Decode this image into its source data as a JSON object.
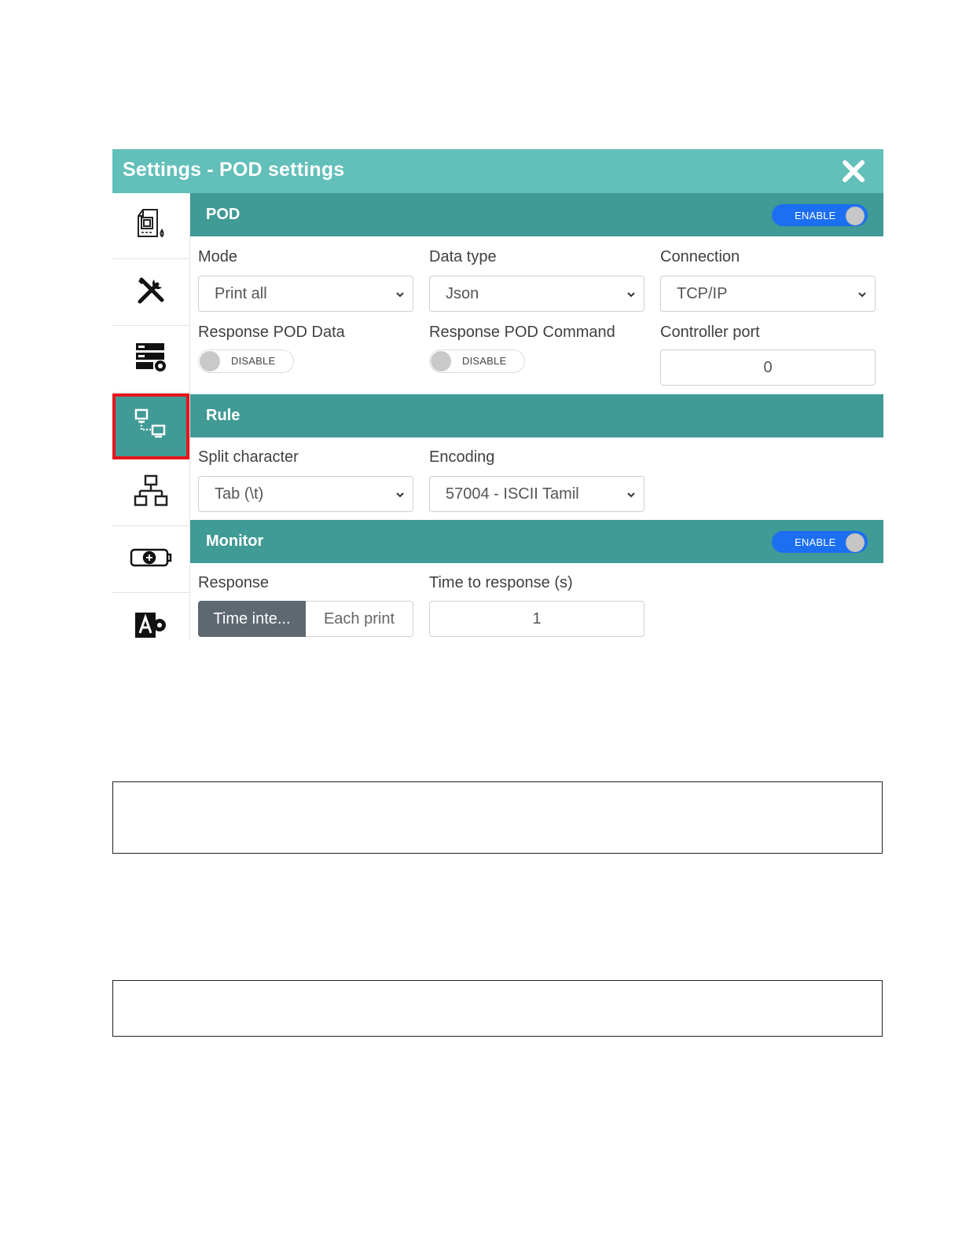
{
  "dialog": {
    "title": "Settings - POD settings",
    "close_icon": "close-icon"
  },
  "sidebar": {
    "items": [
      {
        "icon": "printer-ink-icon",
        "active": false
      },
      {
        "icon": "tools-icon",
        "active": false
      },
      {
        "icon": "server-settings-icon",
        "active": false
      },
      {
        "icon": "network-computers-icon",
        "active": true
      },
      {
        "icon": "hierarchy-icon",
        "active": false
      },
      {
        "icon": "battery-add-icon",
        "active": false
      },
      {
        "icon": "translate-settings-icon",
        "active": false
      }
    ]
  },
  "pod": {
    "title": "POD",
    "toggle": "ENABLE",
    "mode_label": "Mode",
    "mode_value": "Print all",
    "data_type_label": "Data type",
    "data_type_value": "Json",
    "connection_label": "Connection",
    "connection_value": "TCP/IP",
    "response_data_label": "Response POD Data",
    "response_data_toggle": "DISABLE",
    "response_command_label": "Response POD Command",
    "response_command_toggle": "DISABLE",
    "controller_port_label": "Controller port",
    "controller_port_value": "0"
  },
  "rule": {
    "title": "Rule",
    "split_label": "Split character",
    "split_value": "Tab (\\t)",
    "encoding_label": "Encoding",
    "encoding_value": "57004 - ISCII Tamil"
  },
  "monitor": {
    "title": "Monitor",
    "toggle": "ENABLE",
    "response_label": "Response",
    "response_options": [
      "Time inte...",
      "Each print"
    ],
    "time_label": "Time to response (s)",
    "time_value": "1"
  },
  "colors": {
    "title_bar": "#62bfb9",
    "section_header": "#409a95",
    "toggle_on": "#1c6ff0",
    "highlight": "#e8141b"
  }
}
